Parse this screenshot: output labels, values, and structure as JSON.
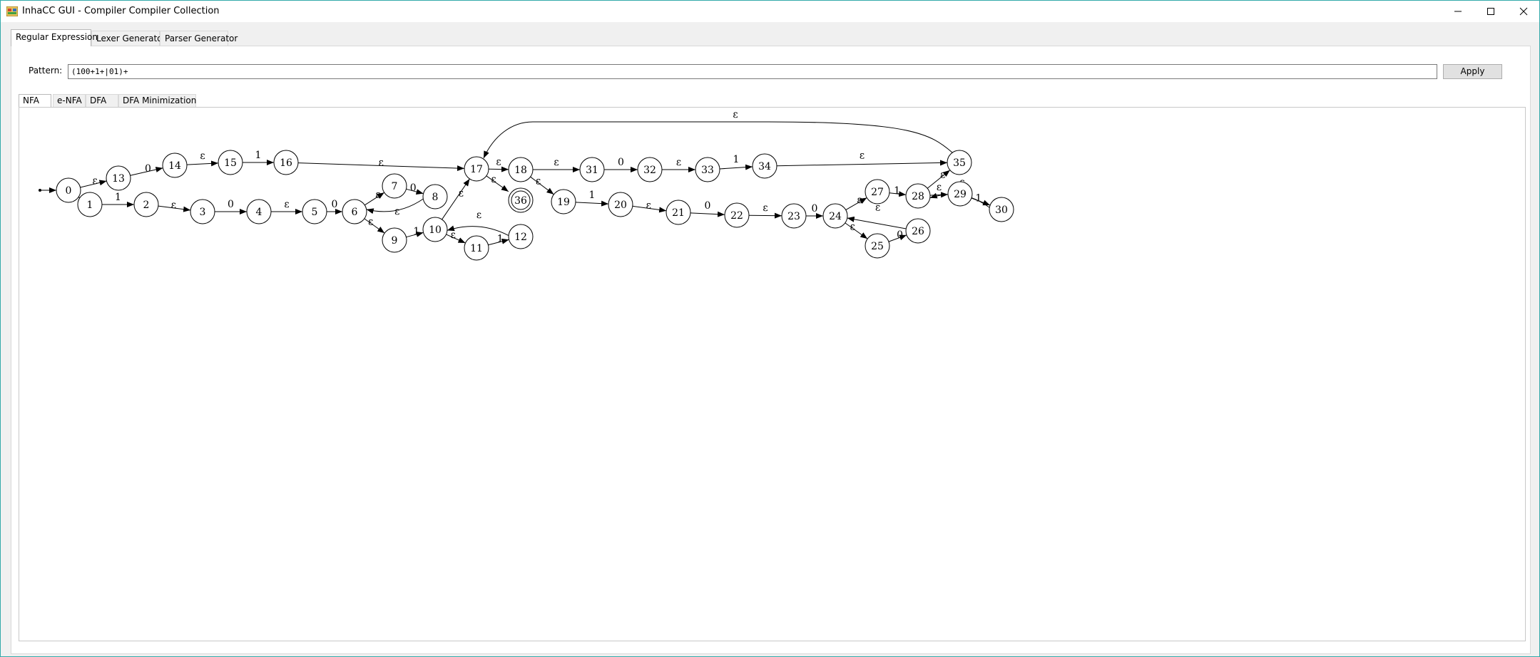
{
  "window": {
    "title": "InhaCC GUI - Compiler Compiler Collection"
  },
  "main_tabs": [
    {
      "label": "Regular Expression",
      "active": true
    },
    {
      "label": "Lexer Generator",
      "active": false
    },
    {
      "label": "Parser Generator",
      "active": false
    }
  ],
  "pattern": {
    "label": "Pattern:",
    "value": "(100+1+|01)+",
    "apply_label": "Apply"
  },
  "view_tabs": [
    {
      "label": "NFA",
      "active": true
    },
    {
      "label": "e-NFA",
      "active": false
    },
    {
      "label": "DFA",
      "active": false
    },
    {
      "label": "DFA Minimization",
      "active": false
    }
  ],
  "nfa": {
    "start_state": "0",
    "accept_states": [
      "36"
    ],
    "states": [
      "0",
      "1",
      "2",
      "3",
      "4",
      "5",
      "6",
      "7",
      "8",
      "9",
      "10",
      "11",
      "12",
      "13",
      "14",
      "15",
      "16",
      "17",
      "18",
      "19",
      "20",
      "21",
      "22",
      "23",
      "24",
      "25",
      "26",
      "27",
      "28",
      "29",
      "30",
      "31",
      "32",
      "33",
      "34",
      "35",
      "36"
    ],
    "transitions": [
      {
        "from": "0",
        "to": "13",
        "label": "ε"
      },
      {
        "from": "0",
        "to": "1",
        "label": "ε"
      },
      {
        "from": "13",
        "to": "14",
        "label": "0"
      },
      {
        "from": "14",
        "to": "15",
        "label": "ε"
      },
      {
        "from": "15",
        "to": "16",
        "label": "1"
      },
      {
        "from": "16",
        "to": "17",
        "label": "ε"
      },
      {
        "from": "1",
        "to": "2",
        "label": "1"
      },
      {
        "from": "2",
        "to": "3",
        "label": "ε"
      },
      {
        "from": "3",
        "to": "4",
        "label": "0"
      },
      {
        "from": "4",
        "to": "5",
        "label": "ε"
      },
      {
        "from": "5",
        "to": "6",
        "label": "0"
      },
      {
        "from": "6",
        "to": "7",
        "label": "ε"
      },
      {
        "from": "7",
        "to": "8",
        "label": "0"
      },
      {
        "from": "8",
        "to": "6",
        "label": "ε"
      },
      {
        "from": "6",
        "to": "9",
        "label": "ε"
      },
      {
        "from": "9",
        "to": "10",
        "label": "1"
      },
      {
        "from": "10",
        "to": "11",
        "label": "ε"
      },
      {
        "from": "11",
        "to": "12",
        "label": "1"
      },
      {
        "from": "12",
        "to": "10",
        "label": "ε"
      },
      {
        "from": "10",
        "to": "17",
        "label": "ε"
      },
      {
        "from": "17",
        "to": "18",
        "label": "ε"
      },
      {
        "from": "17",
        "to": "36",
        "label": "ε"
      },
      {
        "from": "18",
        "to": "31",
        "label": "ε"
      },
      {
        "from": "31",
        "to": "32",
        "label": "0"
      },
      {
        "from": "32",
        "to": "33",
        "label": "ε"
      },
      {
        "from": "33",
        "to": "34",
        "label": "1"
      },
      {
        "from": "34",
        "to": "35",
        "label": "ε"
      },
      {
        "from": "18",
        "to": "19",
        "label": "ε"
      },
      {
        "from": "19",
        "to": "20",
        "label": "1"
      },
      {
        "from": "20",
        "to": "21",
        "label": "ε"
      },
      {
        "from": "21",
        "to": "22",
        "label": "0"
      },
      {
        "from": "22",
        "to": "23",
        "label": "ε"
      },
      {
        "from": "23",
        "to": "24",
        "label": "0"
      },
      {
        "from": "24",
        "to": "27",
        "label": "ε"
      },
      {
        "from": "27",
        "to": "28",
        "label": "1"
      },
      {
        "from": "24",
        "to": "25",
        "label": "ε"
      },
      {
        "from": "25",
        "to": "26",
        "label": "0"
      },
      {
        "from": "26",
        "to": "24",
        "label": "ε"
      },
      {
        "from": "28",
        "to": "29",
        "label": "ε"
      },
      {
        "from": "29",
        "to": "30",
        "label": "1"
      },
      {
        "from": "30",
        "to": "28",
        "label": "ε"
      },
      {
        "from": "28",
        "to": "35",
        "label": "ε"
      },
      {
        "from": "35",
        "to": "17",
        "label": "ε"
      }
    ]
  }
}
